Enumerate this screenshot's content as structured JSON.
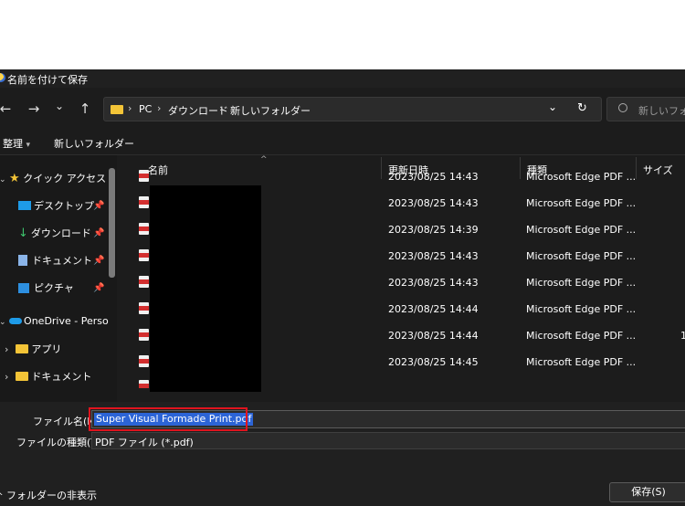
{
  "window": {
    "title": "名前を付けて保存"
  },
  "nav": {
    "back_icon": "←",
    "forward_icon": "→",
    "history_icon": "⌄",
    "up_icon": "↑",
    "breadcrumb": [
      "PC",
      "ダウンロード",
      "新しいフォルダー"
    ],
    "sep": "›",
    "dropdown_icon": "⌄",
    "refresh_icon": "↻",
    "search_placeholder": "新しいフォル"
  },
  "toolbar": {
    "organize_label": "整理",
    "organize_arrow": "▾",
    "new_folder_label": "新しいフォルダー"
  },
  "sidebar": {
    "quick_access": "クイック アクセス",
    "items": [
      {
        "label": "デスクトップ"
      },
      {
        "label": "ダウンロード"
      },
      {
        "label": "ドキュメント"
      },
      {
        "label": "ピクチャ"
      }
    ],
    "onedrive": "OneDrive - Perso",
    "sub_items": [
      {
        "label": "アプリ"
      },
      {
        "label": "ドキュメント"
      }
    ],
    "pin_icon": "📌",
    "expand_icon": "›",
    "collapse_icon": "⌄"
  },
  "columns": {
    "name": "名前",
    "date": "更新日時",
    "type": "種類",
    "size": "サイズ",
    "sort_icon": "^"
  },
  "files": [
    {
      "date": "2023/08/25 14:43",
      "type": "Microsoft Edge PDF ...",
      "size": ""
    },
    {
      "date": "2023/08/25 14:43",
      "type": "Microsoft Edge PDF ...",
      "size": ""
    },
    {
      "date": "2023/08/25 14:39",
      "type": "Microsoft Edge PDF ...",
      "size": ""
    },
    {
      "date": "2023/08/25 14:43",
      "type": "Microsoft Edge PDF ...",
      "size": ""
    },
    {
      "date": "2023/08/25 14:43",
      "type": "Microsoft Edge PDF ...",
      "size": ""
    },
    {
      "date": "2023/08/25 14:44",
      "type": "Microsoft Edge PDF ...",
      "size": ""
    },
    {
      "date": "2023/08/25 14:44",
      "type": "Microsoft Edge PDF ...",
      "size": "1"
    },
    {
      "date": "2023/08/25 14:45",
      "type": "Microsoft Edge PDF ...",
      "size": ""
    }
  ],
  "form": {
    "filename_label": "ファイル名(N):",
    "filename_value": "Super Visual Formade Print.pdf",
    "filetype_label": "ファイルの種類(T):",
    "filetype_value": "PDF ファイル (*.pdf)"
  },
  "footer": {
    "hide_folders": "フォルダーの非表示",
    "hide_icon": "^",
    "save_label": "保存(S)"
  },
  "colors": {
    "accent": "#2c64d6",
    "highlight_border": "#e0141e",
    "folder": "#f3c437",
    "bg": "#1c1c1c"
  }
}
